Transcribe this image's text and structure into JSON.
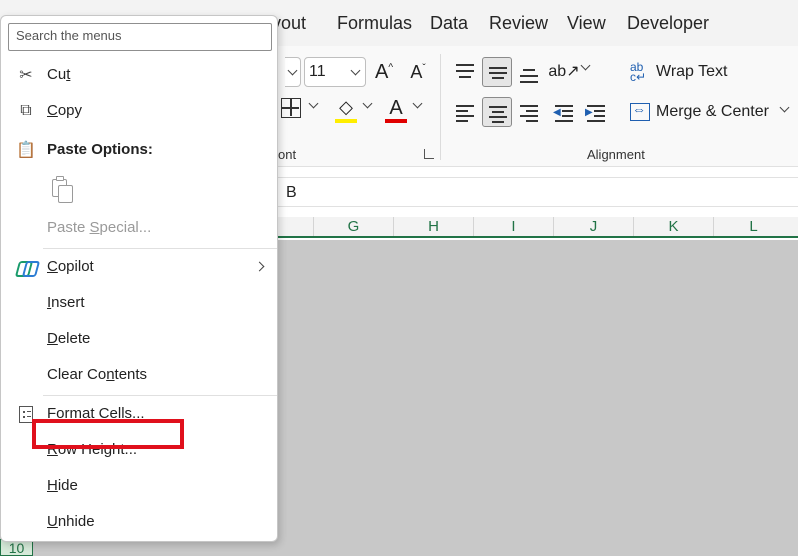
{
  "ribbon_tabs": [
    "yout",
    "Formulas",
    "Data",
    "Review",
    "View",
    "Developer"
  ],
  "font_size": "11",
  "font_group_label": "ont",
  "alignment_group_label": "Alignment",
  "wrap_text": "Wrap Text",
  "merge_center": "Merge & Center",
  "formula_bar_text": "B",
  "columns": [
    "G",
    "H",
    "I",
    "J",
    "K",
    "L"
  ],
  "visible_row": "10",
  "colors": {
    "accent_green": "#217346",
    "fill_yellow": "#ffee00",
    "font_red": "#e00000",
    "highlight_red": "#e0101c"
  },
  "menu": {
    "search_placeholder": "Search the menus",
    "items": [
      {
        "name": "cut",
        "pre": "Cu",
        "u": "t",
        "post": "",
        "icon": "scissors-icon"
      },
      {
        "name": "copy",
        "pre": "",
        "u": "C",
        "post": "opy",
        "icon": "copy-icon"
      },
      {
        "name": "paste-options",
        "label": "Paste Options:",
        "icon": "clipboard-icon"
      },
      {
        "name": "paste-special",
        "pre": "Paste ",
        "u": "S",
        "post": "pecial...",
        "disabled": true
      },
      {
        "name": "copilot",
        "pre": "",
        "u": "C",
        "post": "opilot",
        "icon": "copilot-icon",
        "submenu": true
      },
      {
        "name": "insert",
        "pre": "",
        "u": "I",
        "post": "nsert"
      },
      {
        "name": "delete",
        "pre": "",
        "u": "D",
        "post": "elete"
      },
      {
        "name": "clear-contents",
        "pre": "Clear Co",
        "u": "n",
        "post": "tents"
      },
      {
        "name": "format-cells",
        "pre": "",
        "u": "F",
        "post": "ormat Cells...",
        "icon": "format-cells-icon"
      },
      {
        "name": "row-height",
        "pre": "",
        "u": "R",
        "post": "ow Height...",
        "highlighted": true
      },
      {
        "name": "hide",
        "pre": "",
        "u": "H",
        "post": "ide"
      },
      {
        "name": "unhide",
        "pre": "",
        "u": "U",
        "post": "nhide"
      }
    ]
  }
}
